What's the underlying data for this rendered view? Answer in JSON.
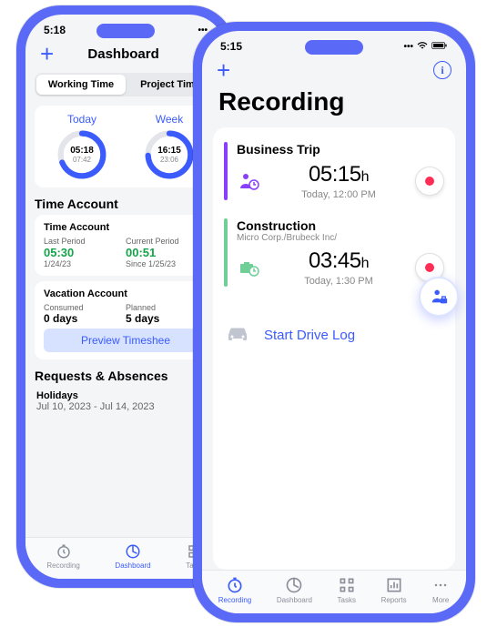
{
  "phoneA": {
    "status_time": "5:18",
    "add_label": "+",
    "title": "Dashboard",
    "segments": {
      "working": "Working Time",
      "project": "Project Time"
    },
    "rings": {
      "today": {
        "label": "Today",
        "value": "05:18",
        "sub": "07:42"
      },
      "week": {
        "label": "Week",
        "value": "16:15",
        "sub": "23:06"
      }
    },
    "time_account_title": "Time Account",
    "time_account": {
      "heading": "Time Account",
      "last": {
        "label": "Last Period",
        "value": "05:30",
        "date": "1/24/23"
      },
      "current": {
        "label": "Current Period",
        "value": "00:51",
        "date": "Since 1/25/23"
      }
    },
    "vacation": {
      "heading": "Vacation Account",
      "consumed": {
        "label": "Consumed",
        "value": "0 days"
      },
      "planned": {
        "label": "Planned",
        "value": "5 days"
      }
    },
    "preview_label": "Preview Timeshee",
    "requests_title": "Requests & Absences",
    "request": {
      "title": "Holidays",
      "dates": "Jul 10, 2023 - Jul 14, 2023"
    },
    "tabs": {
      "recording": "Recording",
      "dashboard": "Dashboard",
      "tasks": "Tasks"
    }
  },
  "phoneB": {
    "status_time": "5:15",
    "add_label": "+",
    "title": "Recording",
    "entry1": {
      "title": "Business Trip",
      "time": "05:15",
      "unit": "h",
      "date": "Today, 12:00 PM"
    },
    "entry2": {
      "title": "Construction",
      "sub": "Micro Corp./Brubeck Inc/",
      "time": "03:45",
      "unit": "h",
      "date": "Today, 1:30 PM"
    },
    "drive_label": "Start Drive Log",
    "tabs": {
      "recording": "Recording",
      "dashboard": "Dashboard",
      "tasks": "Tasks",
      "reports": "Reports",
      "more": "More"
    }
  }
}
